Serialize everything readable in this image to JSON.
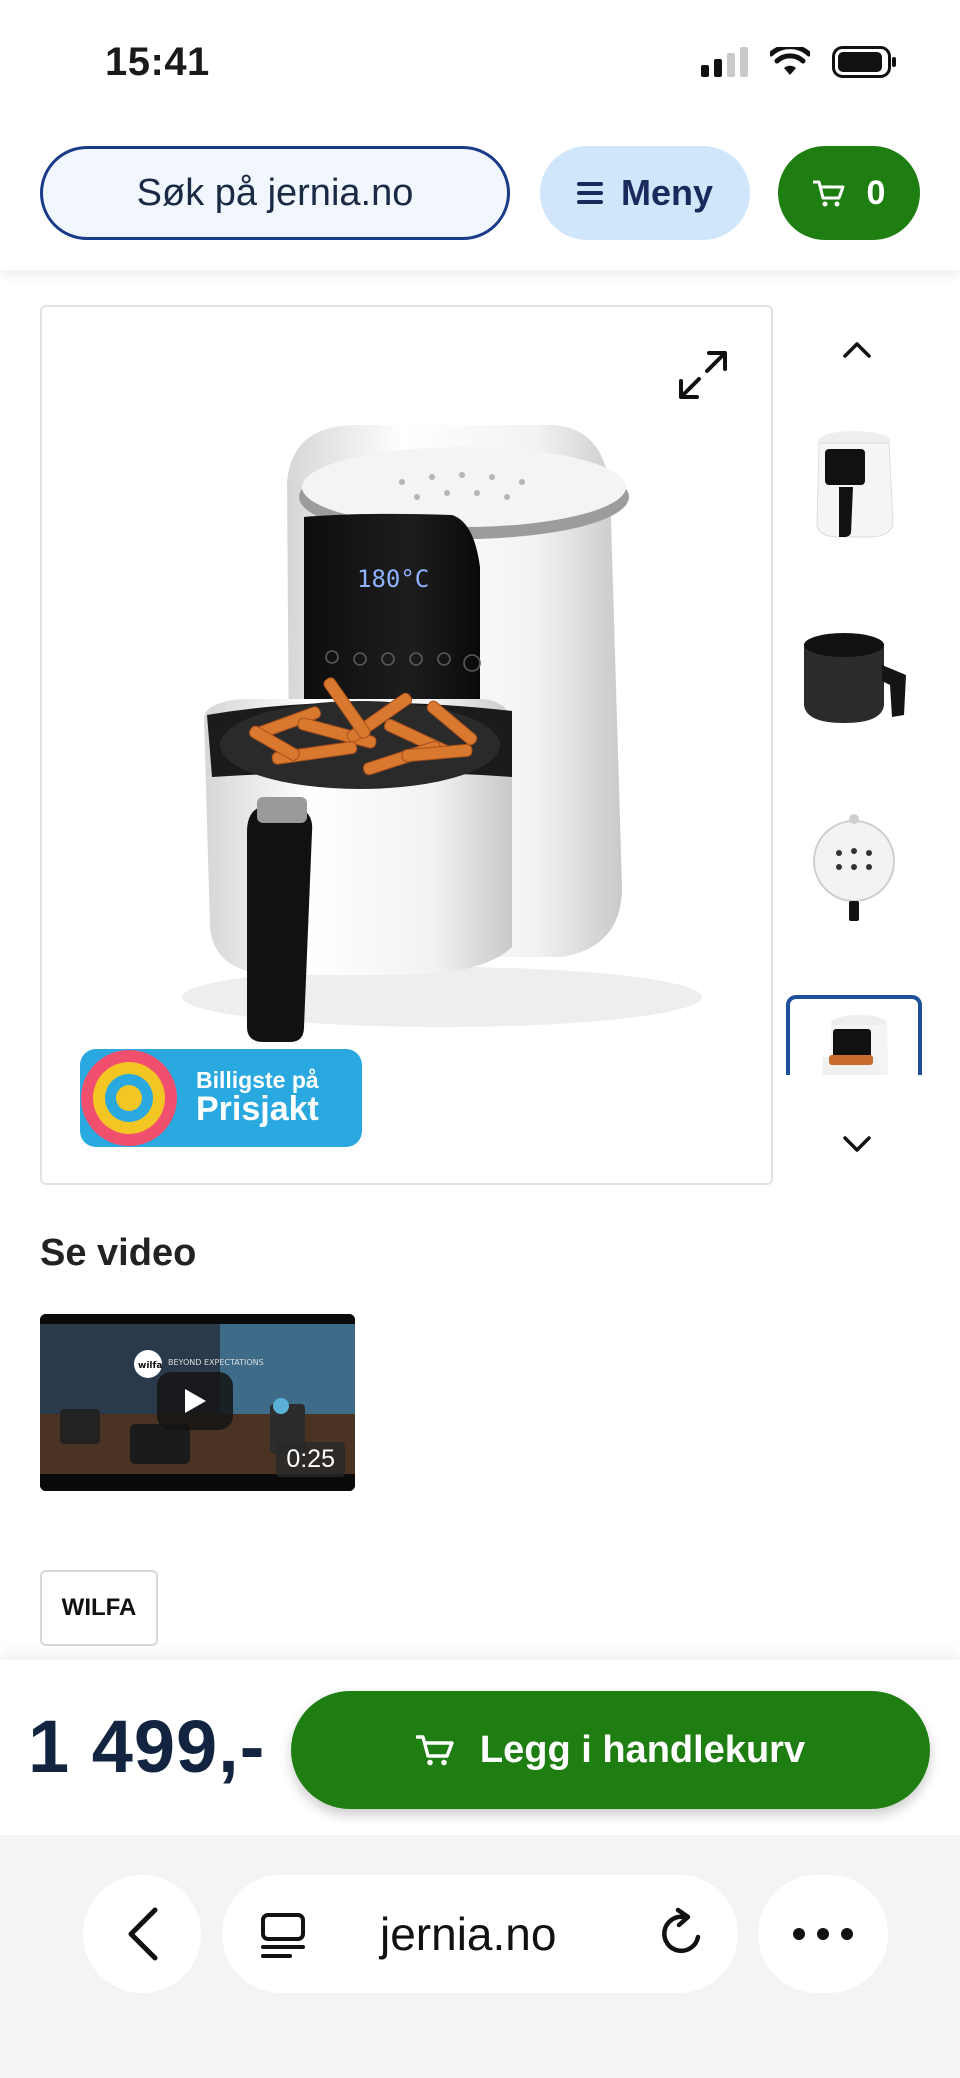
{
  "status_bar": {
    "time": "15:41",
    "icons": [
      "signal-icon",
      "wifi-icon",
      "battery-icon"
    ]
  },
  "header": {
    "search_placeholder": "Søk på jernia.no",
    "menu_label": "Meny",
    "cart_count": "0"
  },
  "gallery": {
    "badge_line1": "Billigste på",
    "badge_line2": "Prisjakt",
    "thumbnails": [
      "Airfryer front view",
      "Airfryer basket",
      "Airfryer top panel",
      "Airfryer with fries"
    ],
    "active_thumbnail": 4
  },
  "video": {
    "title": "Se video",
    "duration": "0:25",
    "overlay_brand": "wilfa",
    "overlay_tagline": "BEYOND EXPECTATIONS"
  },
  "brand": "WILFA",
  "buy_bar": {
    "price": "1 499,-",
    "add_to_cart_label": "Legg i handlekurv"
  },
  "browser": {
    "url": "jernia.no"
  },
  "colors": {
    "primary_green": "#1f7e12",
    "navy": "#1a3a8a",
    "menu_bg": "#cfe6fb",
    "badge_blue": "#2aa9e0"
  }
}
